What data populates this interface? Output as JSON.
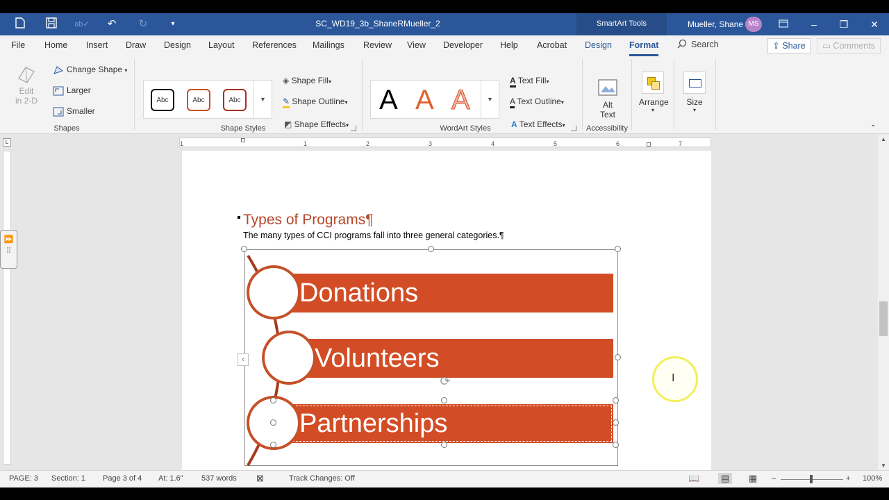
{
  "titlebar": {
    "doc_title": "SC_WD19_3b_ShaneRMueller_2",
    "context_tab_group": "SmartArt Tools",
    "user_name": "Mueller, Shane",
    "user_initials": "MS",
    "brand_color": "#2b579a"
  },
  "tabs": [
    "File",
    "Home",
    "Insert",
    "Draw",
    "Design",
    "Layout",
    "References",
    "Mailings",
    "Review",
    "View",
    "Developer",
    "Help",
    "Acrobat",
    "Design",
    "Format"
  ],
  "active_tab": "Format",
  "search_label": "Search",
  "share_label": "Share",
  "comments_label": "Comments",
  "ribbon": {
    "shapes": {
      "edit_2d": "Edit\nin 2-D",
      "change_shape": "Change Shape",
      "larger": "Larger",
      "smaller": "Smaller",
      "label": "Shapes"
    },
    "shape_styles": {
      "abc": [
        "Abc",
        "Abc",
        "Abc"
      ],
      "shape_fill": "Shape Fill",
      "shape_outline": "Shape Outline",
      "shape_effects": "Shape Effects",
      "label": "Shape Styles"
    },
    "wordart_styles": {
      "letters": [
        "A",
        "A",
        "A"
      ],
      "text_fill": "Text Fill",
      "text_outline": "Text Outline",
      "text_effects": "Text Effects",
      "label": "WordArt Styles"
    },
    "accessibility": {
      "alt_text": "Alt\nText",
      "label": "Accessibility"
    },
    "arrange": "Arrange",
    "size": "Size"
  },
  "ruler_numbers": [
    "1",
    "1",
    "2",
    "3",
    "4",
    "5",
    "6",
    "7"
  ],
  "document": {
    "heading": "Types of Programs¶",
    "body": "The many types of CCI programs fall into three general categories.¶",
    "smartart_items": [
      "Donations",
      "Volunteers",
      "Partnerships"
    ],
    "accent_color": "#d24d26"
  },
  "statusbar": {
    "page": "PAGE: 3",
    "section": "Section: 1",
    "page_of": "Page 3 of 4",
    "at": "At: 1.6\"",
    "words": "537 words",
    "track_changes": "Track Changes: Off",
    "zoom": "100%"
  }
}
